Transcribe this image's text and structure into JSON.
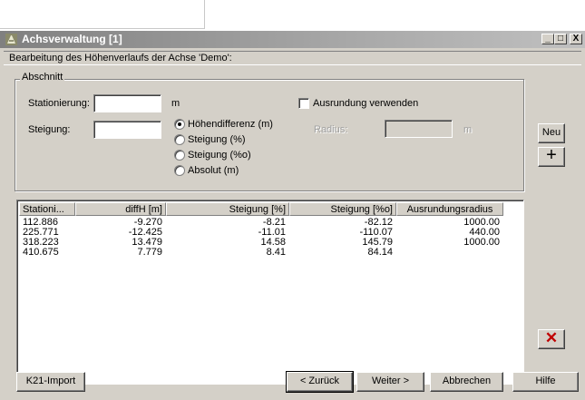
{
  "window": {
    "title": "Achsverwaltung [1]",
    "controls": {
      "minimize": "_",
      "maximize": "□",
      "close": "X"
    }
  },
  "description": "Bearbeitung des Höhenverlaufs der Achse  'Demo':",
  "abschnitt": {
    "group_label": "Abschnitt",
    "stationierung_label": "Stationierung:",
    "stationierung_value": "",
    "stationierung_unit": "m",
    "steigung_label": "Steigung:",
    "steigung_value": "",
    "radio_options": [
      "Höhendifferenz (m)",
      "Steigung (%)",
      "Steigung (%o)",
      "Absolut (m)"
    ],
    "radio_selected": "Höhendifferenz (m)",
    "ausrundung_label": "Ausrundung verwenden",
    "ausrundung_checked": false,
    "radius_label": "Radius:",
    "radius_value": "",
    "radius_unit": "m"
  },
  "side_buttons": {
    "neu": "Neu",
    "add": "+",
    "delete": "✕"
  },
  "table": {
    "columns": [
      "Stationi...",
      "diffH [m]",
      "Steigung [%]",
      "Steigung [%o]",
      "Ausrundungsradius"
    ],
    "rows": [
      [
        "112.886",
        "-9.270",
        "-8.21",
        "-82.12",
        "1000.00"
      ],
      [
        "225.771",
        "-12.425",
        "-11.01",
        "-110.07",
        "440.00"
      ],
      [
        "318.223",
        "13.479",
        "14.58",
        "145.79",
        "1000.00"
      ],
      [
        "410.675",
        "7.779",
        "8.41",
        "84.14",
        ""
      ]
    ]
  },
  "footer": {
    "k21_import": "K21-Import",
    "back": "< Zurück",
    "next": "Weiter >",
    "cancel": "Abbrechen",
    "help": "Hilfe"
  }
}
